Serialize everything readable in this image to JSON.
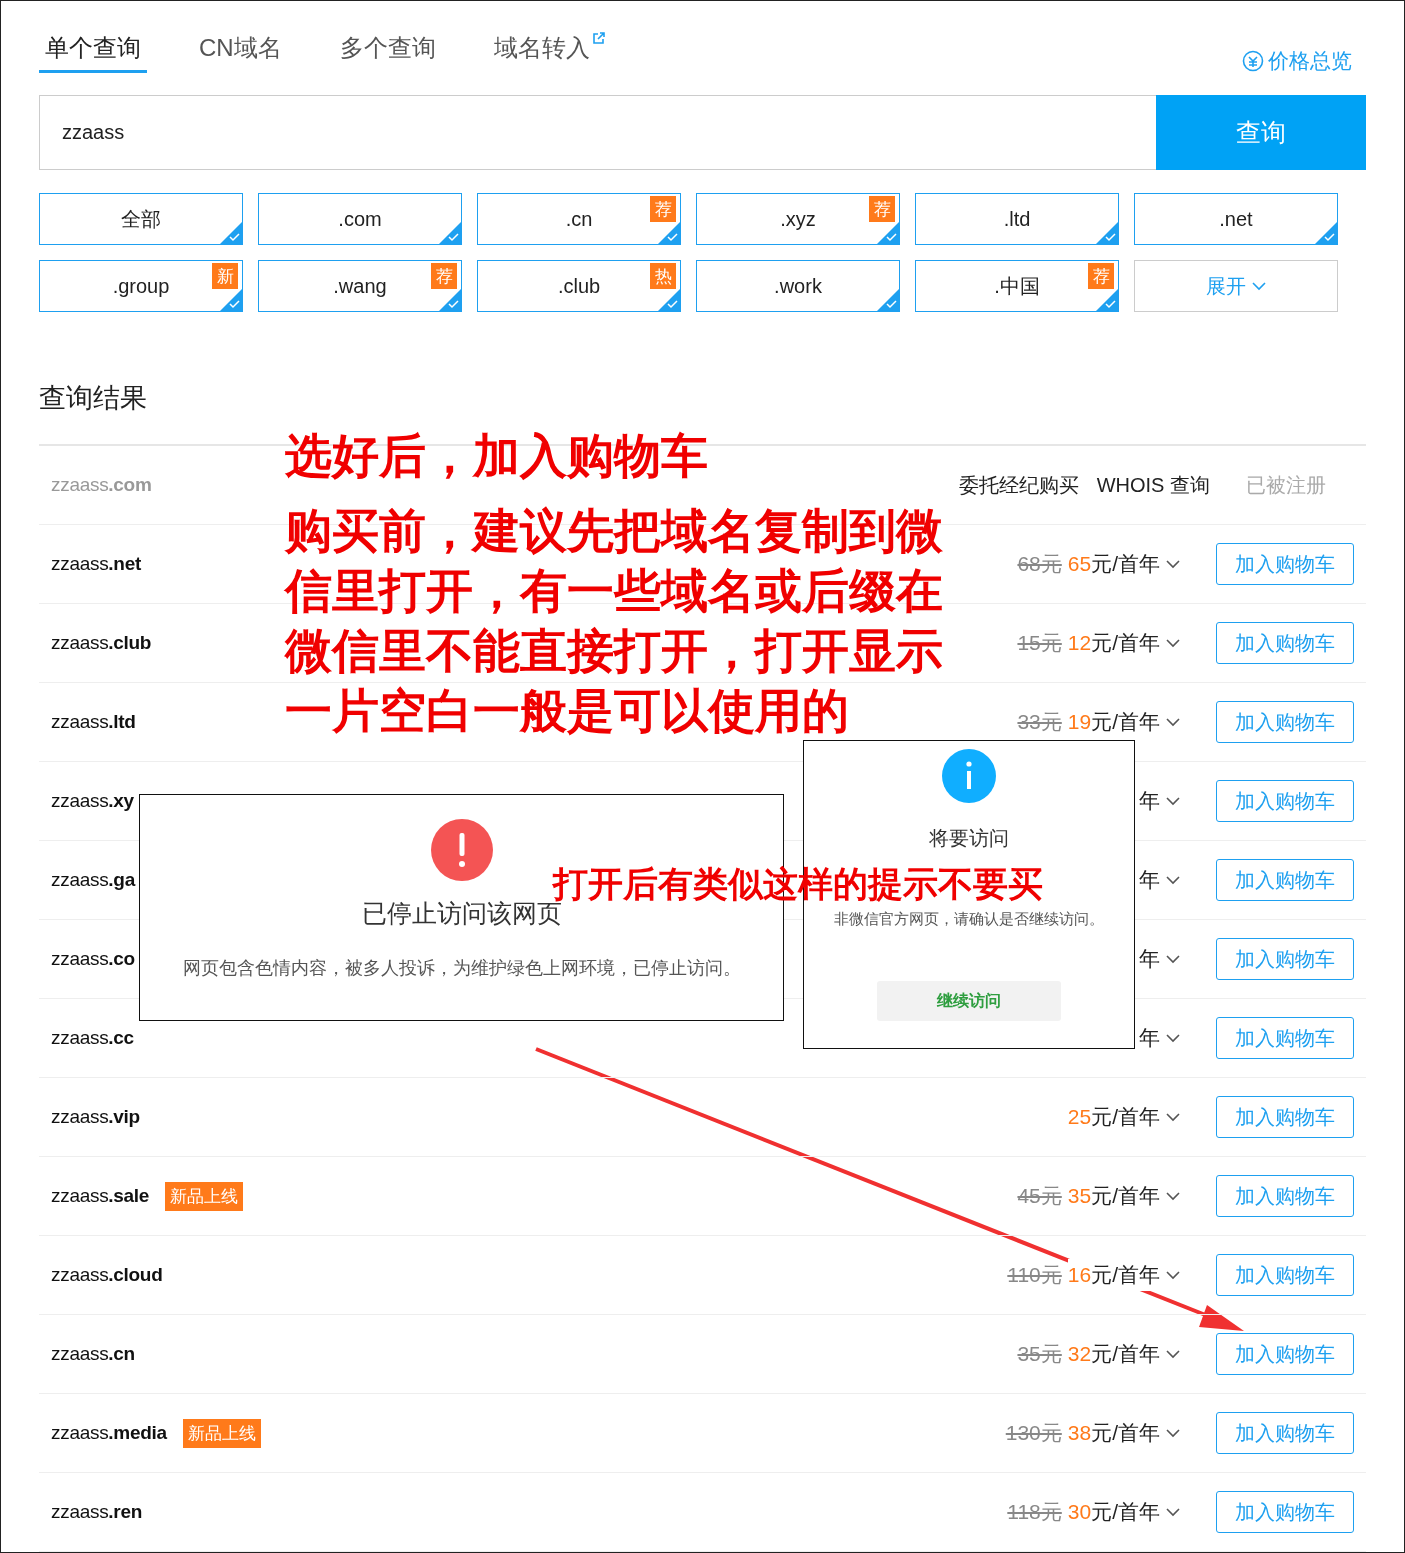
{
  "tabs": [
    {
      "label": "单个查询",
      "selected": true,
      "external": false
    },
    {
      "label": "CN域名",
      "selected": false,
      "external": false
    },
    {
      "label": "多个查询",
      "selected": false,
      "external": false
    },
    {
      "label": "域名转入",
      "selected": false,
      "external": true
    }
  ],
  "price_overview": "价格总览",
  "search": {
    "value": "zzaass",
    "button": "查询"
  },
  "suffixes": [
    {
      "kind": "suffix",
      "label": "全部",
      "checked": true
    },
    {
      "kind": "suffix",
      "label": ".com",
      "checked": true
    },
    {
      "kind": "suffix",
      "label": ".cn",
      "badge": "荐",
      "checked": true
    },
    {
      "kind": "suffix",
      "label": ".xyz",
      "badge": "荐",
      "checked": true
    },
    {
      "kind": "suffix",
      "label": ".ltd",
      "checked": true
    },
    {
      "kind": "suffix",
      "label": ".net",
      "checked": true
    },
    {
      "kind": "suffix",
      "label": ".group",
      "badge": "新",
      "checked": true
    },
    {
      "kind": "suffix",
      "label": ".wang",
      "badge": "荐",
      "checked": true
    },
    {
      "kind": "suffix",
      "label": ".club",
      "badge": "热",
      "checked": true
    },
    {
      "kind": "suffix",
      "label": ".work",
      "checked": true
    },
    {
      "kind": "suffix",
      "label": ".中国",
      "badge": "荐",
      "checked": true
    },
    {
      "kind": "expand",
      "label": "展开"
    }
  ],
  "results_title": "查询结果",
  "results": [
    {
      "kind": "registered",
      "name": "zzaass**.com**",
      "actions": [
        "委托经纪购买",
        "WHOIS 查询"
      ],
      "status": "已被注册"
    },
    {
      "kind": "available",
      "name": "zzaass**.net**",
      "old_price": "68元",
      "price": "65",
      "unit": "元/首年",
      "button": "加入购物车"
    },
    {
      "kind": "available",
      "name": "zzaass**.club**",
      "old_price": "15元",
      "price": "12",
      "unit": "元/首年",
      "button": "加入购物车"
    },
    {
      "kind": "available",
      "name": "zzaass**.ltd**",
      "old_price": "33元",
      "price": "19",
      "unit": "元/首年",
      "button": "加入购物车"
    },
    {
      "kind": "available",
      "name": "zzaass**.xy**",
      "unit": "年",
      "button": "加入购物车"
    },
    {
      "kind": "available",
      "name": "zzaass**.ga**",
      "unit": "年",
      "button": "加入购物车"
    },
    {
      "kind": "available",
      "name": "zzaass**.co**",
      "unit": "年",
      "button": "加入购物车"
    },
    {
      "kind": "available",
      "name": "zzaass**.cc**",
      "unit": "年",
      "button": "加入购物车"
    },
    {
      "kind": "available",
      "name": "zzaass**.vip**",
      "price": "25",
      "unit": "元/首年",
      "button": "加入购物车"
    },
    {
      "kind": "available",
      "name": "zzaass**.sale**",
      "tag": "新品上线",
      "old_price": "45元",
      "price": "35",
      "unit": "元/首年",
      "button": "加入购物车"
    },
    {
      "kind": "available",
      "name": "zzaass**.cloud**",
      "old_price": "110元",
      "price": "16",
      "unit": "元/首年",
      "button": "加入购物车"
    },
    {
      "kind": "available",
      "name": "zzaass**.cn**",
      "old_price": "35元",
      "price": "32",
      "unit": "元/首年",
      "button": "加入购物车"
    },
    {
      "kind": "available",
      "name": "zzaass**.media**",
      "tag": "新品上线",
      "old_price": "130元",
      "price": "38",
      "unit": "元/首年",
      "button": "加入购物车"
    },
    {
      "kind": "available",
      "name": "zzaass**.ren**",
      "old_price": "118元",
      "price": "30",
      "unit": "元/首年",
      "button": "加入购物车"
    }
  ],
  "dialogs": [
    {
      "kind": "blocked",
      "title": "已停止访问该网页",
      "message": "网页包含色情内容，被多人投诉，为维护绿色上网环境，已停止访问。"
    },
    {
      "kind": "notice",
      "title": "将要访问",
      "message": "非微信官方网页，请确认是否继续访问。",
      "button": "继续访问"
    }
  ],
  "annotations": [
    {
      "kind": "headline",
      "text": "选好后，加入购物车"
    },
    {
      "kind": "paragraph",
      "text": "购买前，建议先把域名复制到微信里打开，有一些域名或后缀在微信里不能直接打开，打开显示一片空白一般是可以使用的"
    },
    {
      "kind": "warning",
      "text": "打开后有类似这样的提示不要买"
    }
  ]
}
